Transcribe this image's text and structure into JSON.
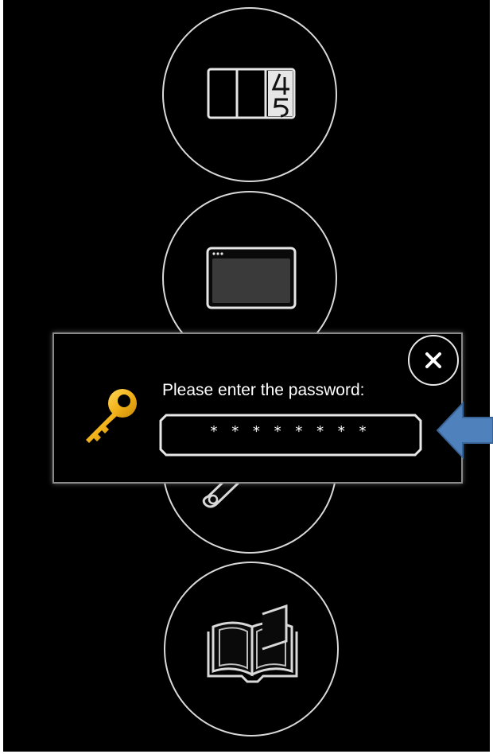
{
  "dialog": {
    "prompt": "Please enter the password:",
    "password_mask": "* * * * * * * *"
  },
  "menu": {
    "items": [
      {
        "icon": "counter-display-icon"
      },
      {
        "icon": "app-window-icon"
      },
      {
        "icon": "wrench-icon"
      },
      {
        "icon": "book-icon"
      }
    ]
  },
  "colors": {
    "background": "#000000",
    "circle_stroke": "#d9d9d9",
    "key_gold": "#f2b21a",
    "arrow_blue": "#4f81bd"
  }
}
